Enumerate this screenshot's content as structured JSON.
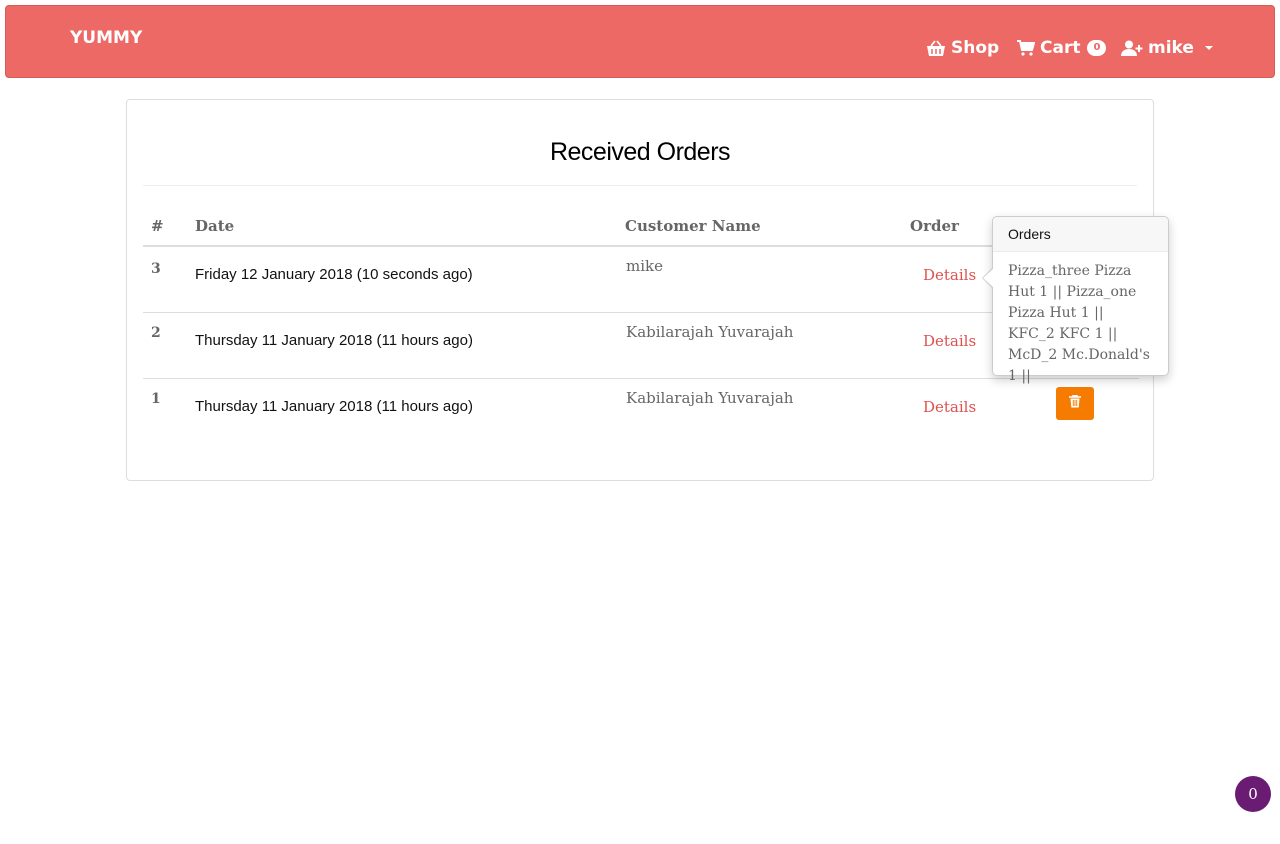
{
  "navbar": {
    "brand": "YUMMY",
    "shop_label": "Shop",
    "cart_label": "Cart",
    "cart_count": "0",
    "user_label": "mike",
    "accent": "#ec6966"
  },
  "panel": {
    "title": "Received Orders"
  },
  "table": {
    "headers": [
      "#",
      "Date",
      "Customer Name",
      "Order"
    ],
    "rows": [
      {
        "num": "3",
        "date": "Friday 12 January 2018 (10 seconds ago)",
        "customer": "mike",
        "link": "Details"
      },
      {
        "num": "2",
        "date": "Thursday 11 January 2018 (11 hours ago)",
        "customer": "Kabilarajah Yuvarajah",
        "link": "Details"
      },
      {
        "num": "1",
        "date": "Thursday 11 January 2018 (11 hours ago)",
        "customer": "Kabilarajah Yuvarajah",
        "link": "Details"
      }
    ]
  },
  "popover": {
    "title": "Orders",
    "body": "Pizza_three Pizza Hut 1 || Pizza_one Pizza Hut 1 || KFC_2 KFC 1 || McD_2 Mc.Donald's 1 ||"
  },
  "float_badge": "0",
  "icons": {
    "shop": "basket-icon",
    "cart": "cart-icon",
    "user": "user-plus-icon",
    "delete": "trash-icon"
  }
}
